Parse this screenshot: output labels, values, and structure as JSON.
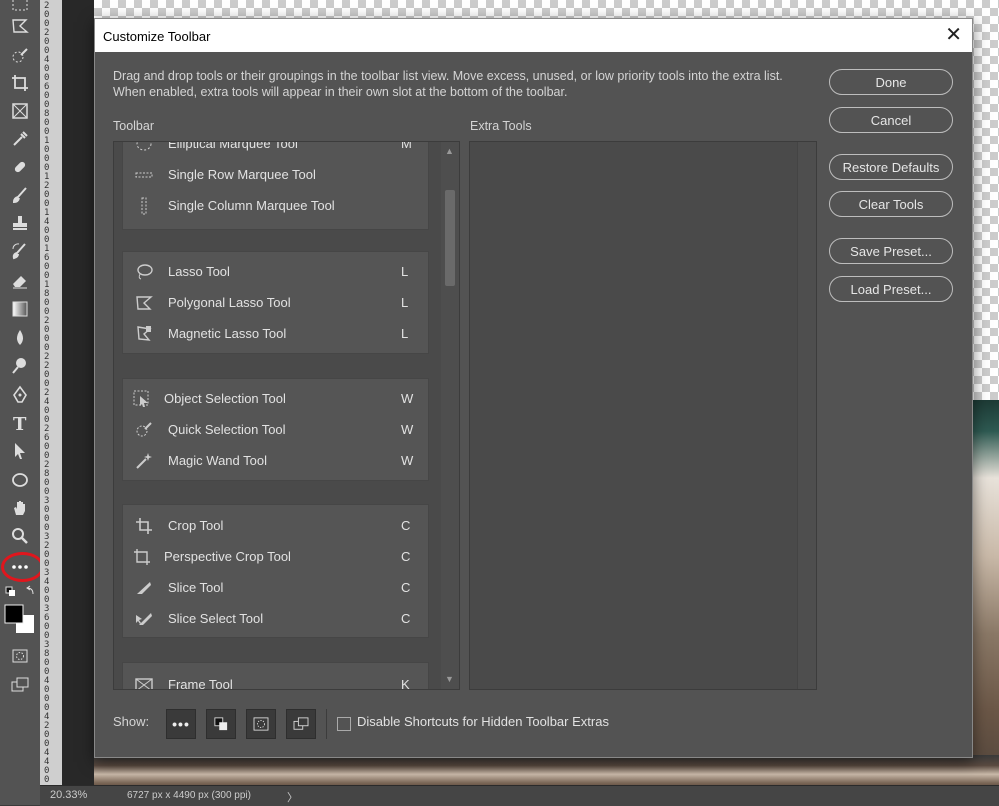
{
  "dialog": {
    "title": "Customize Toolbar",
    "close_glyph": "✕",
    "description": "Drag and drop tools or their groupings in the toolbar list view. Move excess, unused, or low priority tools into the extra list. When enabled, extra tools will appear in their own slot at the bottom of the toolbar.",
    "toolbar_label": "Toolbar",
    "extra_label": "Extra Tools",
    "buttons": {
      "done": "Done",
      "cancel": "Cancel",
      "restore": "Restore Defaults",
      "clear": "Clear Tools",
      "save_preset": "Save Preset...",
      "load_preset": "Load Preset..."
    },
    "show_label": "Show:",
    "disable_shortcuts": "Disable Shortcuts for Hidden Toolbar Extras",
    "groups": [
      {
        "tools": [
          {
            "name": "Elliptical Marquee Tool",
            "shortcut": "M",
            "icon": "elliptical-marquee-icon"
          },
          {
            "name": "Single Row Marquee Tool",
            "shortcut": "",
            "icon": "single-row-marquee-icon"
          },
          {
            "name": "Single Column Marquee Tool",
            "shortcut": "",
            "icon": "single-column-marquee-icon"
          }
        ]
      },
      {
        "tools": [
          {
            "name": "Lasso Tool",
            "shortcut": "L",
            "icon": "lasso-icon"
          },
          {
            "name": "Polygonal Lasso Tool",
            "shortcut": "L",
            "icon": "polygonal-lasso-icon"
          },
          {
            "name": "Magnetic Lasso Tool",
            "shortcut": "L",
            "icon": "magnetic-lasso-icon"
          }
        ]
      },
      {
        "tools": [
          {
            "name": "Object Selection Tool",
            "shortcut": "W",
            "icon": "object-selection-icon"
          },
          {
            "name": "Quick Selection Tool",
            "shortcut": "W",
            "icon": "quick-selection-icon"
          },
          {
            "name": "Magic Wand Tool",
            "shortcut": "W",
            "icon": "magic-wand-icon"
          }
        ]
      },
      {
        "tools": [
          {
            "name": "Crop Tool",
            "shortcut": "C",
            "icon": "crop-icon"
          },
          {
            "name": "Perspective Crop Tool",
            "shortcut": "C",
            "icon": "perspective-crop-icon"
          },
          {
            "name": "Slice Tool",
            "shortcut": "C",
            "icon": "slice-icon"
          },
          {
            "name": "Slice Select Tool",
            "shortcut": "C",
            "icon": "slice-select-icon"
          }
        ]
      },
      {
        "tools": [
          {
            "name": "Frame Tool",
            "shortcut": "K",
            "icon": "frame-icon"
          }
        ]
      }
    ]
  },
  "status_bar": {
    "zoom": "20.33%",
    "doc_info": "6727 px x 4490 px (300 ppi)",
    "arrow": "〉"
  },
  "ruler": {
    "numbers": [
      "2",
      "0",
      "0",
      "2",
      "0",
      "0",
      "4",
      "0",
      "0",
      "6",
      "0",
      "0",
      "8",
      "0",
      "0",
      "1",
      "0",
      "0",
      "0",
      "1",
      "2",
      "0",
      "0",
      "1",
      "4",
      "0",
      "0",
      "1",
      "6",
      "0",
      "0",
      "1",
      "8",
      "0",
      "0",
      "2",
      "0",
      "0",
      "0",
      "2",
      "2",
      "0",
      "0",
      "2",
      "4",
      "0",
      "0",
      "2",
      "6",
      "0",
      "0",
      "2",
      "8",
      "0",
      "0",
      "3",
      "0",
      "0",
      "0",
      "3",
      "2",
      "0",
      "0",
      "3",
      "4",
      "0",
      "0",
      "3",
      "6",
      "0",
      "0",
      "3",
      "8",
      "0",
      "0",
      "4",
      "0",
      "0",
      "0",
      "4",
      "2",
      "0",
      "0",
      "4",
      "4",
      "0",
      "0"
    ]
  },
  "accent_colors": {
    "highlight": "#e0161d",
    "dialog_bg": "#535353",
    "panel_bg": "#4a4a4a"
  }
}
